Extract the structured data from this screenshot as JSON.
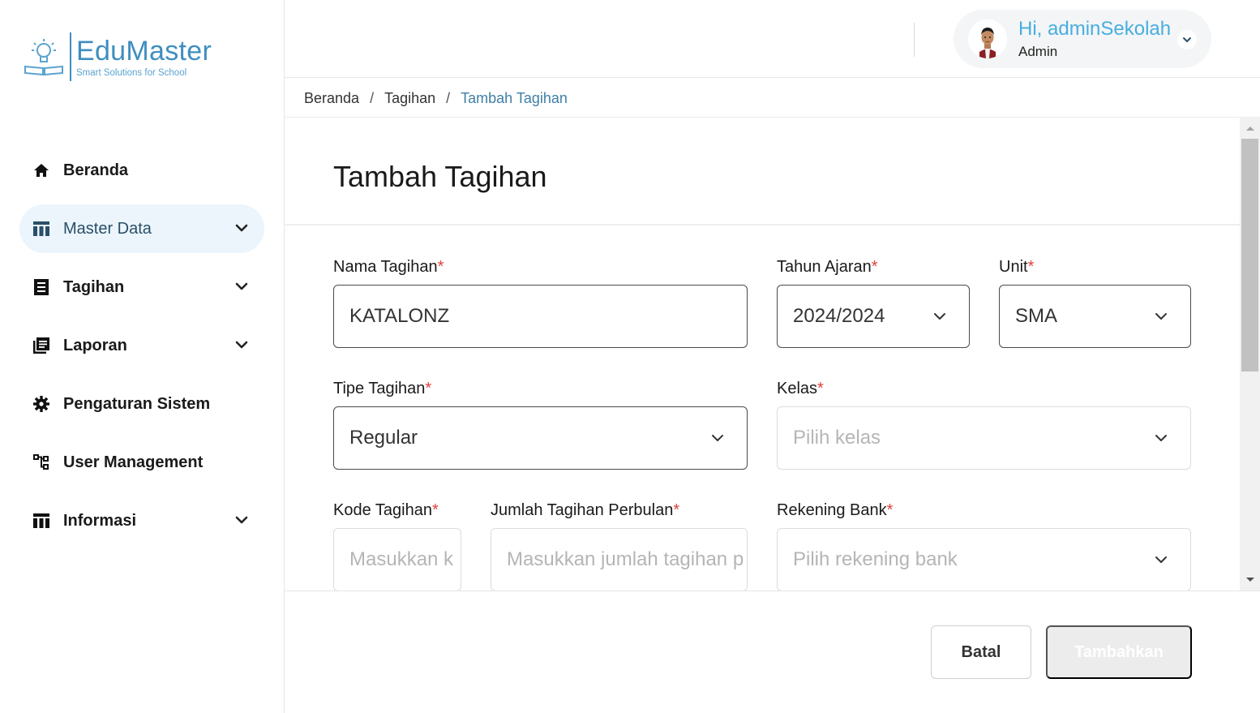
{
  "brand": {
    "name": "EduMaster",
    "tagline": "Smart Solutions for School",
    "color": "#3f8ec0"
  },
  "sidebar": {
    "items": [
      {
        "label": "Beranda",
        "icon": "home-icon",
        "active": false,
        "expandable": false
      },
      {
        "label": "Master Data",
        "icon": "table-icon",
        "active": true,
        "expandable": true
      },
      {
        "label": "Tagihan",
        "icon": "list-icon",
        "active": false,
        "expandable": true
      },
      {
        "label": "Laporan",
        "icon": "library-icon",
        "active": false,
        "expandable": true
      },
      {
        "label": "Pengaturan Sistem",
        "icon": "gear-icon",
        "active": false,
        "expandable": false
      },
      {
        "label": "User Management",
        "icon": "hierarchy-icon",
        "active": false,
        "expandable": false
      },
      {
        "label": "Informasi",
        "icon": "table-icon",
        "active": false,
        "expandable": true
      }
    ]
  },
  "header": {
    "greeting": "Hi, adminSekolah",
    "role": "Admin"
  },
  "breadcrumb": {
    "items": [
      "Beranda",
      "Tagihan",
      "Tambah Tagihan"
    ],
    "separator": "/"
  },
  "form": {
    "title": "Tambah Tagihan",
    "required_mark": "*",
    "fields": {
      "nama_tagihan": {
        "label": "Nama Tagihan",
        "value": "KATALONZ"
      },
      "tahun_ajaran": {
        "label": "Tahun Ajaran",
        "value": "2024/2024"
      },
      "unit": {
        "label": "Unit",
        "value": "SMA"
      },
      "tipe_tagihan": {
        "label": "Tipe Tagihan",
        "value": "Regular"
      },
      "kelas": {
        "label": "Kelas",
        "placeholder": "Pilih kelas"
      },
      "kode_tagihan": {
        "label": "Kode Tagihan",
        "placeholder": "Masukkan k"
      },
      "jumlah_tagihan": {
        "label": "Jumlah Tagihan Perbulan",
        "placeholder": "Masukkan jumlah tagihan p"
      },
      "rekening_bank": {
        "label": "Rekening Bank",
        "placeholder": "Pilih rekening bank"
      }
    }
  },
  "actions": {
    "cancel": "Batal",
    "submit": "Tambahkan"
  },
  "colors": {
    "accent": "#47aee0",
    "required": "#e0413c",
    "active_bg": "#ebf5fb"
  }
}
